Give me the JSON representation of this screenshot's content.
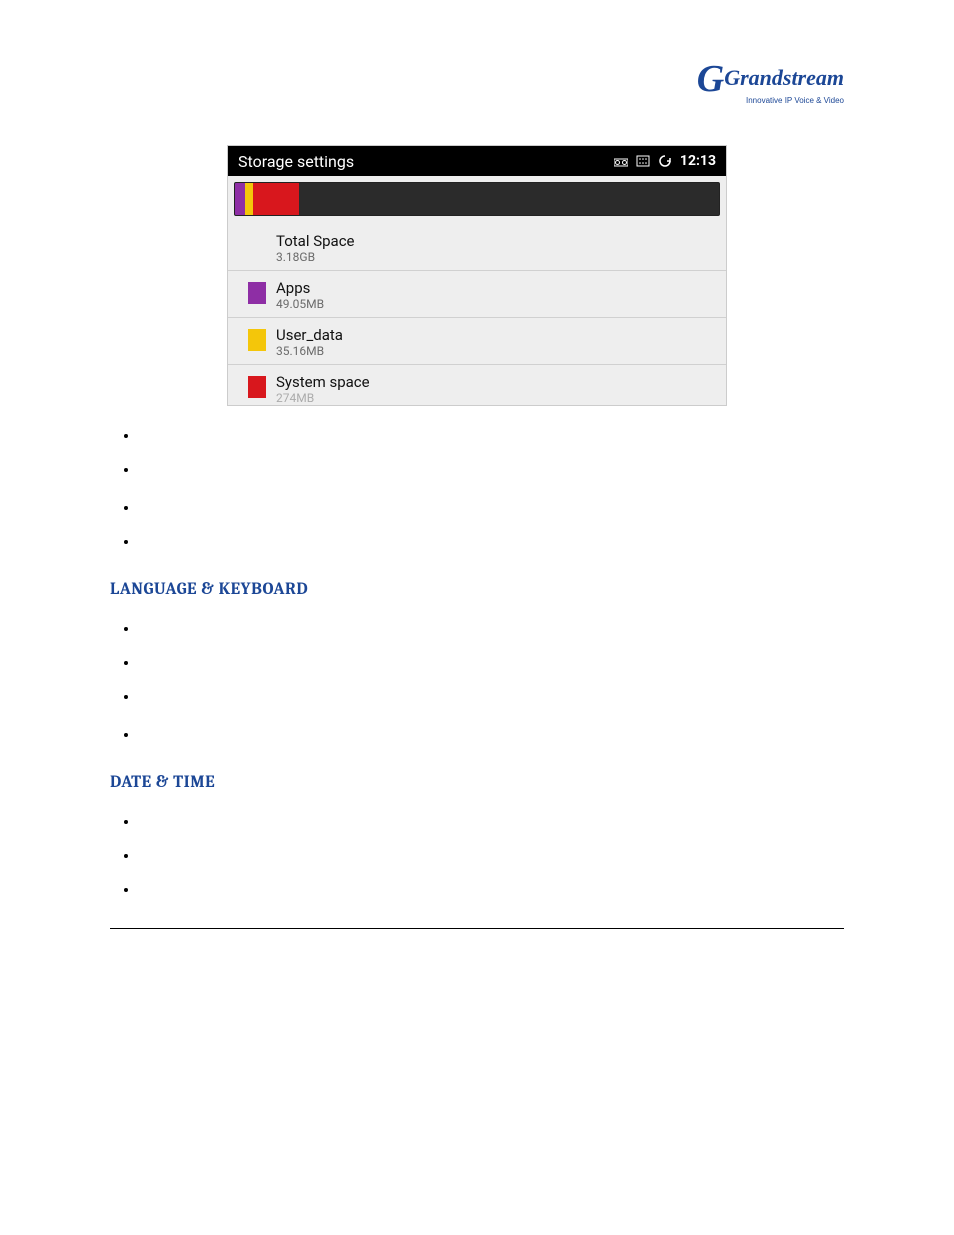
{
  "logo": {
    "brand": "Grandstream",
    "tagline": "Innovative IP Voice & Video"
  },
  "screenshot": {
    "title": "Storage settings",
    "clock": "12:13",
    "rows": [
      {
        "label": "Total Space",
        "value": "3.18GB",
        "swatch": "none"
      },
      {
        "label": "Apps",
        "value": "49.05MB",
        "swatch": "apps"
      },
      {
        "label": "User_data",
        "value": "35.16MB",
        "swatch": "user"
      },
      {
        "label": "System space",
        "value": "274MB",
        "swatch": "sys"
      }
    ]
  },
  "sections": {
    "language_keyboard": "LANGUAGE & KEYBOARD",
    "date_time": "DATE & TIME"
  }
}
